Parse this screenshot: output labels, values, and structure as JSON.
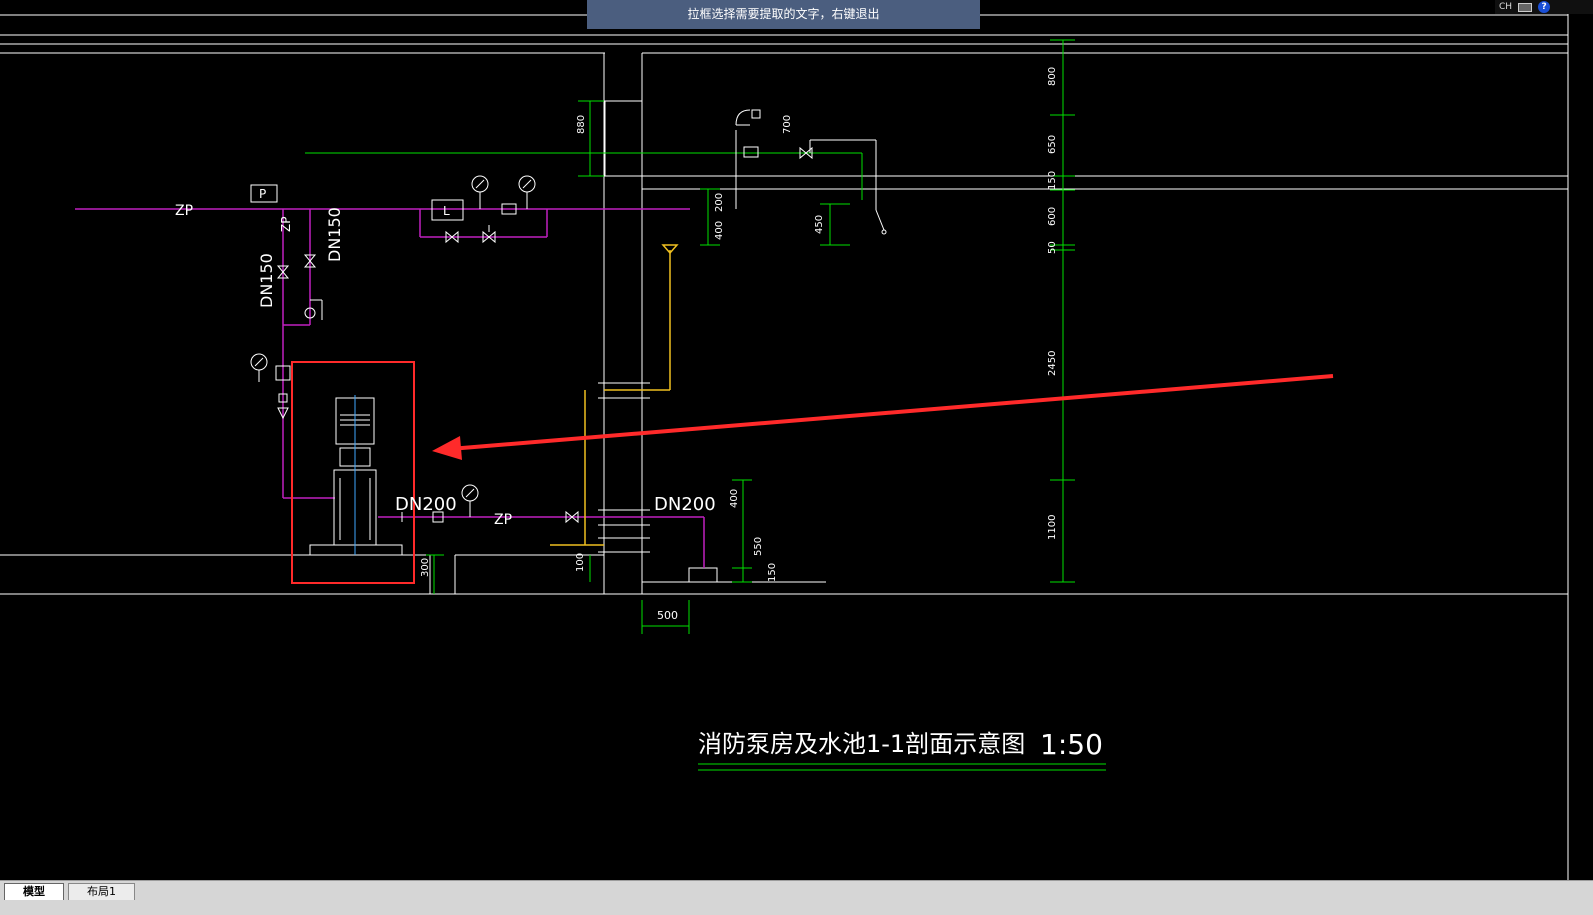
{
  "window": {
    "banner_text": "拉框选择需要提取的文字，右键退出",
    "lang_indicator": "CH",
    "help_glyph": "?"
  },
  "drawing": {
    "title": "消防泵房及水池1-1剖面示意图",
    "scale": "1:50",
    "pipe_labels": {
      "zp_left": "ZP",
      "zp_vertical": "ZP",
      "zp_bottom": "ZP",
      "dn150_a": "DN150",
      "dn150_b": "DN150",
      "dn200_a": "DN200",
      "dn200_b": "DN200",
      "p_box": "P",
      "l_box": "L"
    },
    "dimensions_right": [
      "800",
      "650",
      "150",
      "600",
      "50",
      "2450",
      "1100"
    ],
    "dimensions_misc": {
      "wall_880": "880",
      "valve_700": "700",
      "d200": "200",
      "d400": "400",
      "d450": "450",
      "d400b": "400",
      "d550": "550",
      "d150": "150",
      "d300": "300",
      "d100": "100",
      "d500": "500"
    },
    "highlight_color": "#ff2a2a"
  },
  "tabs": {
    "model": "模型",
    "layout1": "布局1"
  }
}
